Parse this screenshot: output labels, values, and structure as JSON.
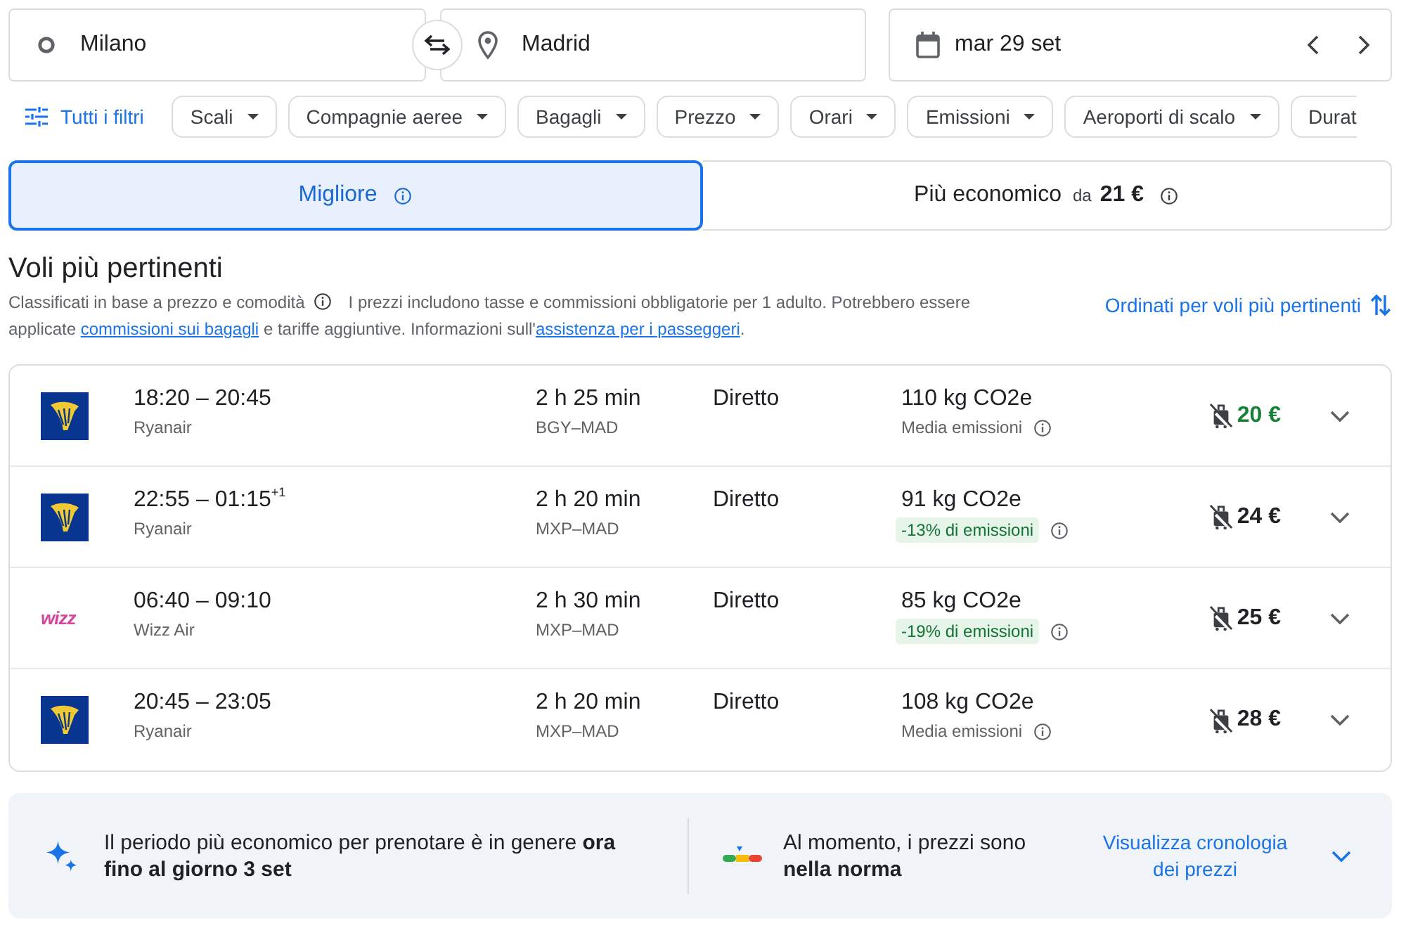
{
  "trip": {
    "origin": "Milano",
    "destination": "Madrid",
    "date": "mar 29 set"
  },
  "filters": {
    "all_filters": "Tutti i filtri",
    "chips": [
      {
        "label": "Scali",
        "clipped": false
      },
      {
        "label": "Compagnie aeree",
        "clipped": false
      },
      {
        "label": "Bagagli",
        "clipped": false
      },
      {
        "label": "Prezzo",
        "clipped": false
      },
      {
        "label": "Orari",
        "clipped": false
      },
      {
        "label": "Emissioni",
        "clipped": false
      },
      {
        "label": "Aeroporti di scalo",
        "clipped": false
      },
      {
        "label": "Durat",
        "clipped": true
      }
    ]
  },
  "sort_tabs": [
    {
      "label": "Migliore",
      "selected": true
    },
    {
      "label": "Più economico",
      "price_prefix": "da",
      "price": "21 €",
      "selected": false
    }
  ],
  "results": {
    "title": "Voli più pertinenti",
    "description": [
      {
        "kind": "text",
        "text": "Classificati in base a prezzo e comodità"
      },
      {
        "kind": "info"
      },
      {
        "kind": "text",
        "text": "I prezzi includono tasse e commissioni obbligatorie per 1 adulto. Potrebbero essere applicate "
      },
      {
        "kind": "link",
        "text": "commissioni sui bagagli"
      },
      {
        "kind": "text",
        "text": " e tariffe aggiuntive. Informazioni sull'"
      },
      {
        "kind": "link",
        "text": "assistenza per i passeggeri"
      },
      {
        "kind": "text",
        "text": "."
      }
    ],
    "sort_link": "Ordinati per voli più pertinenti"
  },
  "flights": [
    {
      "logo": {
        "kind": "harp"
      },
      "times": "18:20 – 20:45",
      "airline": "Ryanair",
      "duration": "2 h 25 min",
      "route": "BGY–MAD",
      "stops": "Diretto",
      "emissions": "110 kg CO2e",
      "emissions_note": {
        "kind": "average",
        "text": "Media emissioni"
      },
      "price": "20 €",
      "best_price": true,
      "expanded": false
    },
    {
      "logo": {
        "kind": "harp"
      },
      "times": "22:55 – 01:15",
      "arrival_offset": "+1",
      "airline": "Ryanair",
      "duration": "2 h 20 min",
      "route": "MXP–MAD",
      "stops": "Diretto",
      "emissions": "91 kg CO2e",
      "emissions_note": {
        "kind": "lower",
        "text": "-13% di emissioni"
      },
      "price": "24 €",
      "best_price": false,
      "expanded": false
    },
    {
      "logo": {
        "kind": "wordmark",
        "text": "wizz"
      },
      "times": "06:40 – 09:10",
      "airline": "Wizz Air",
      "duration": "2 h 30 min",
      "route": "MXP–MAD",
      "stops": "Diretto",
      "emissions": "85 kg CO2e",
      "emissions_note": {
        "kind": "lower",
        "text": "-19% di emissioni"
      },
      "price": "25 €",
      "best_price": false,
      "expanded": false
    },
    {
      "logo": {
        "kind": "harp"
      },
      "times": "20:45 – 23:05",
      "airline": "Ryanair",
      "duration": "2 h 20 min",
      "route": "MXP–MAD",
      "stops": "Diretto",
      "emissions": "108 kg CO2e",
      "emissions_note": {
        "kind": "average",
        "text": "Media emissioni"
      },
      "price": "28 €",
      "best_price": false,
      "expanded": false
    }
  ],
  "insights": {
    "items": [
      {
        "kind": "tip",
        "text": "Il periodo più economico per prenotare è in genere **ora fino al giorno 3 set**"
      },
      {
        "kind": "price_level",
        "text": "Al momento, i prezzi sono **nella norma**"
      }
    ],
    "history_link": "Visualizza cronologia dei prezzi",
    "expanded": false
  }
}
